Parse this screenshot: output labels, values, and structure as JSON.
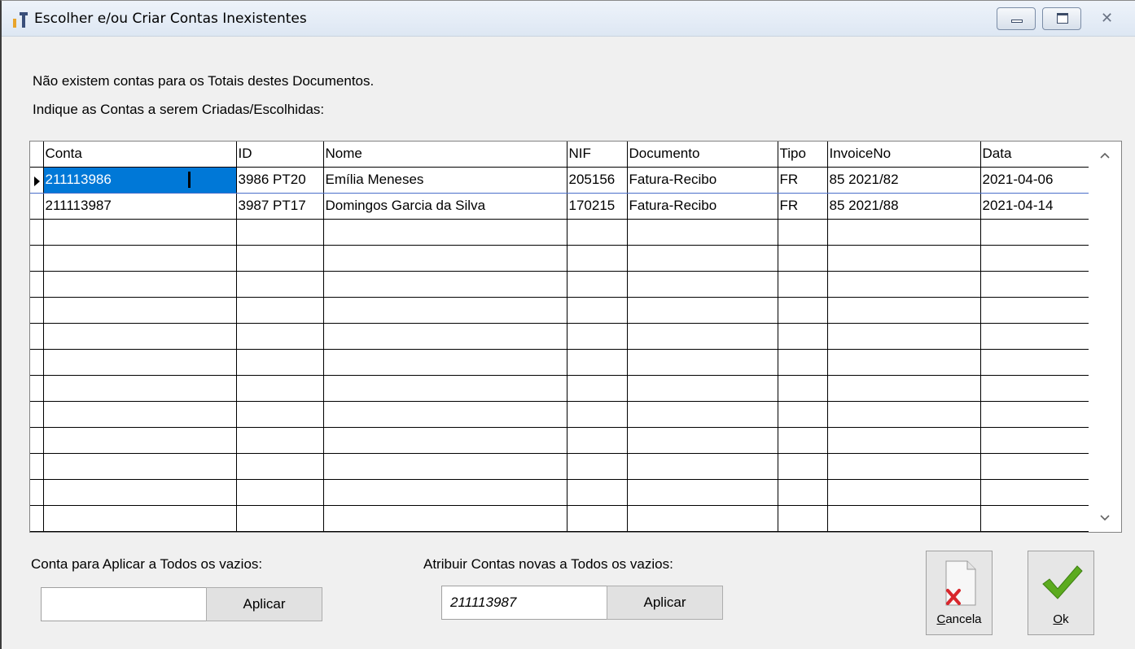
{
  "window": {
    "title": "Escolher e/ou Criar Contas Inexistentes"
  },
  "messages": {
    "line1": "Não existem contas para os Totais destes Documentos.",
    "line2": "Indique as Contas a serem Criadas/Escolhidas:"
  },
  "grid": {
    "columns": [
      "Conta",
      "ID",
      "Nome",
      "NIF",
      "Documento",
      "Tipo",
      "InvoiceNo",
      "Data"
    ],
    "rows": [
      [
        "211113986",
        "3986 PT20",
        "Emília Meneses",
        "205156",
        "Fatura-Recibo",
        "FR",
        "85 2021/82",
        "2021-04-06"
      ],
      [
        "211113987",
        "3987 PT17",
        "Domingos Garcia da Silva",
        "170215",
        "Fatura-Recibo",
        "FR",
        "85 2021/88",
        "2021-04-14"
      ]
    ],
    "empty_rows": 12,
    "scroll_up_icon": "chevron-up-icon",
    "scroll_down_icon": "chevron-down-icon"
  },
  "bottom": {
    "apply_all_label": "Conta para Aplicar a Todos os vazios:",
    "apply_all_value": "",
    "apply_all_button": "Aplicar",
    "assign_new_label": "Atribuir Contas novas a Todos os vazios:",
    "assign_new_value": "211113987",
    "assign_new_button": "Aplicar",
    "cancel_button": {
      "accel": "C",
      "rest": "ancela"
    },
    "ok_button": {
      "accel": "O",
      "rest": "k"
    }
  },
  "colors": {
    "selection": "#0078d7",
    "cancel_x": "#d8262c",
    "ok_check": "#5cab1f"
  }
}
